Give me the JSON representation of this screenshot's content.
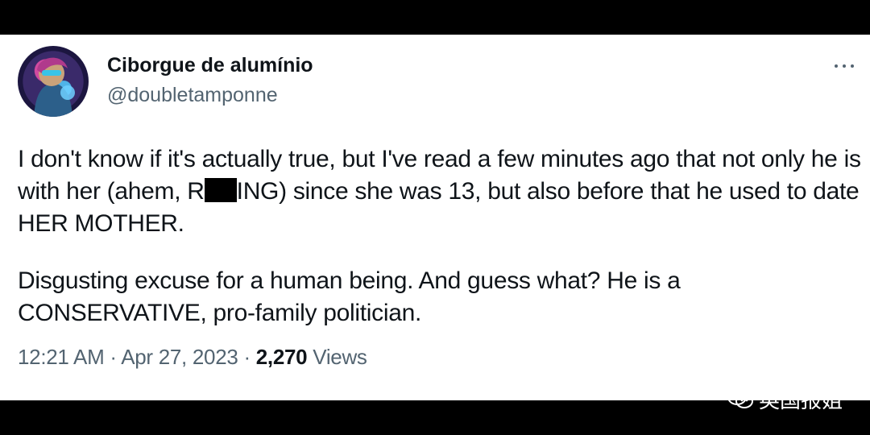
{
  "tweet": {
    "author": {
      "display_name": "Ciborgue de alumínio",
      "handle": "@doubletamponne"
    },
    "body": {
      "p1_before": "I don't know if it's actually true, but I've read a few minutes ago that not only he is with her (ahem, R",
      "p1_after": "ING) since she was 13, but also before that he used to date HER MOTHER.",
      "p2": "Disgusting excuse for a human being. And guess what? He is a CONSERVATIVE, pro-family politician."
    },
    "meta": {
      "time": "12:21 AM",
      "separator": " · ",
      "date": "Apr 27, 2023",
      "views_count": "2,270",
      "views_label": " Views"
    },
    "icons": {
      "more": "more-dots-icon",
      "avatar": "avatar-image"
    }
  },
  "watermark": {
    "text": "英国报姐",
    "icon": "wechat-icon"
  },
  "colors": {
    "background": "#000000",
    "card": "#ffffff",
    "text_primary": "#0f1419",
    "text_secondary": "#536471"
  }
}
